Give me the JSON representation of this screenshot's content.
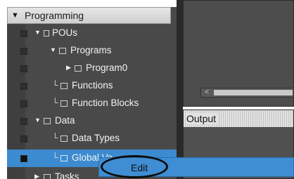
{
  "tree": {
    "header_title": "Programming",
    "items": [
      {
        "label": "POUs"
      },
      {
        "label": "Programs"
      },
      {
        "label": "Program0"
      },
      {
        "label": "Functions"
      },
      {
        "label": "Function Blocks"
      },
      {
        "label": "Data"
      },
      {
        "label": "Data Types"
      },
      {
        "label": "Global Va"
      },
      {
        "label": "Tasks"
      }
    ]
  },
  "output": {
    "title": "Output"
  },
  "context_menu": {
    "edit_label": "Edit"
  },
  "colors": {
    "selection": "#3c8bd0",
    "menu_bg": "#3f8dd3",
    "panel_bg": "#494949"
  },
  "icons": [
    "collapse-arrow-icon",
    "expand-arrow-icon",
    "folder-icon",
    "program-icon",
    "function-icon",
    "data-icon",
    "task-icon"
  ]
}
